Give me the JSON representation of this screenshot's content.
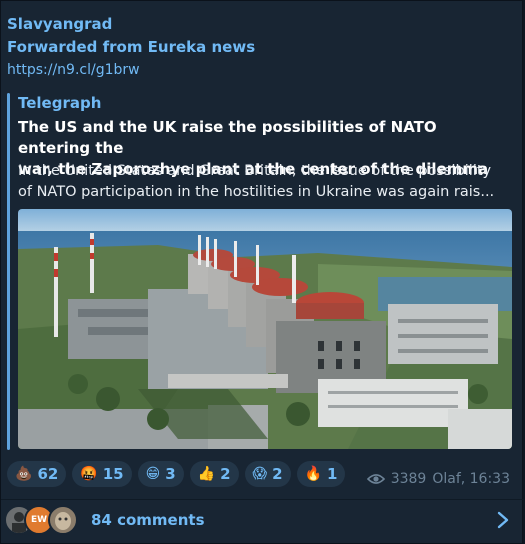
{
  "post": {
    "channel": "Slavyangrad",
    "forwarded": "Forwarded from Eureka news",
    "link": "https://n9.cl/g1brw"
  },
  "preview": {
    "site": "Telegraph",
    "title_line1": "The US and the UK raise the possibilities of NATO entering the",
    "title_line2": "war, the Zaporozhye plant at the center of the dilemma",
    "desc_line1": "In the United States and Great Britain, the issue of the possibility",
    "desc_line2": "of NATO participation in the hostilities in Ukraine was again rais..."
  },
  "reactions": [
    {
      "icon": "poop-emoji",
      "count": "62"
    },
    {
      "icon": "angry-face-emoji",
      "count": "15"
    },
    {
      "icon": "grinning-face-emoji",
      "count": "3"
    },
    {
      "icon": "thumbs-up-emoji",
      "count": "2"
    },
    {
      "icon": "screaming-face-emoji",
      "count": "2"
    },
    {
      "icon": "fire-emoji",
      "count": "1"
    }
  ],
  "meta": {
    "views": "3389",
    "author_time": "Olaf, 16:33"
  },
  "comments": {
    "label": "84 comments",
    "avatar_initials": "EW"
  },
  "colors": {
    "accent": "#71baf5",
    "background": "#182533",
    "reaction_bg": "#233648"
  }
}
